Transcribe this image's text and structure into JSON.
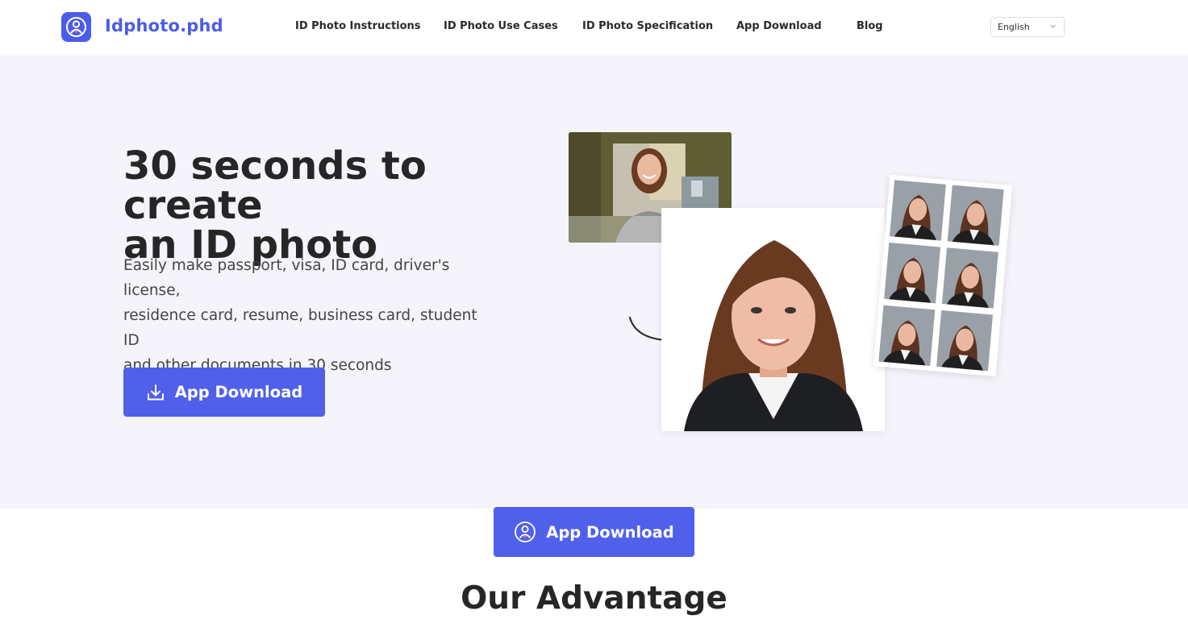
{
  "header": {
    "brand": "Idphoto.phd",
    "nav": [
      {
        "label": "ID Photo Instructions"
      },
      {
        "label": "ID Photo Use Cases"
      },
      {
        "label": "ID Photo Specification"
      },
      {
        "label": "App Download"
      },
      {
        "label": "Blog"
      }
    ],
    "language": "English"
  },
  "hero": {
    "title_line1": "30 seconds to create",
    "title_line2": "an ID photo",
    "desc_line1": "Easily make passport, visa, ID card, driver's license,",
    "desc_line2": "residence card, resume, business card, student ID",
    "desc_line3": "and other documents in 30 seconds",
    "download_label": "App Download"
  },
  "cta": {
    "download_label": "App Download"
  },
  "advantage": {
    "title": "Our Advantage"
  },
  "colors": {
    "accent": "#5060ea",
    "brand": "#4b5ce8",
    "hero_bg": "#f4f4fa"
  },
  "icons": {
    "logo": "person-badge-icon",
    "download": "download-icon",
    "app": "person-badge-icon",
    "dropdown": "chevron-down-icon",
    "arrow": "curved-arrow-icon"
  }
}
